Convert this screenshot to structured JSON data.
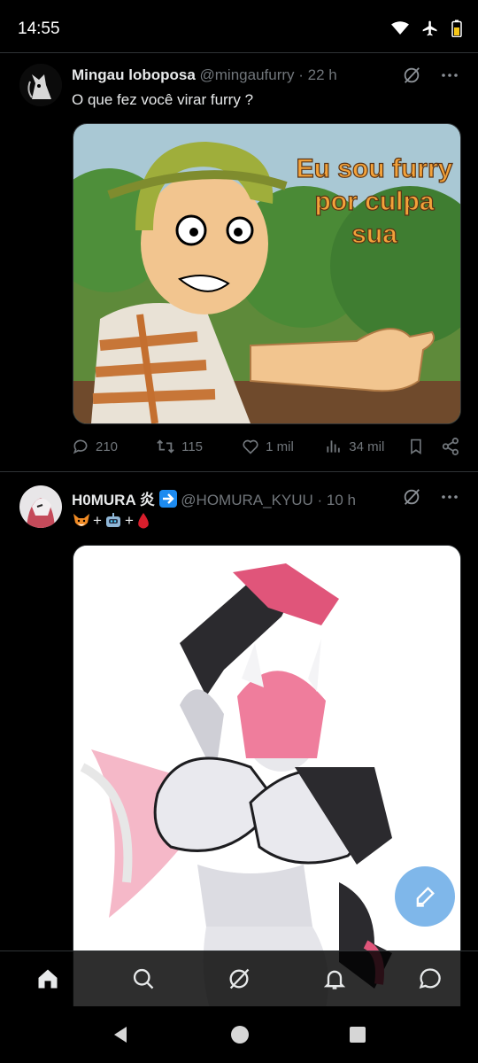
{
  "status_bar": {
    "time": "14:55"
  },
  "tweets": [
    {
      "display_name": "Mingau loboposa",
      "handle": "@mingaufurry",
      "time_ago": "· 22 h",
      "text": "O que fez você virar furry ?",
      "media_caption": "Eu sou furry por culpa sua",
      "replies": "210",
      "retweets": "115",
      "likes": "1 mil",
      "views": "34 mil"
    },
    {
      "display_name": "H0MURA 炎",
      "handle": "@HOMURA_KYUU",
      "time_ago": "· 10 h",
      "text_parts": [
        "+",
        "+"
      ]
    }
  ],
  "colors": {
    "background": "#000000",
    "text_primary": "#e7e9ea",
    "text_secondary": "#71767b",
    "divider": "#2f3336",
    "fab": "#69aae6"
  }
}
